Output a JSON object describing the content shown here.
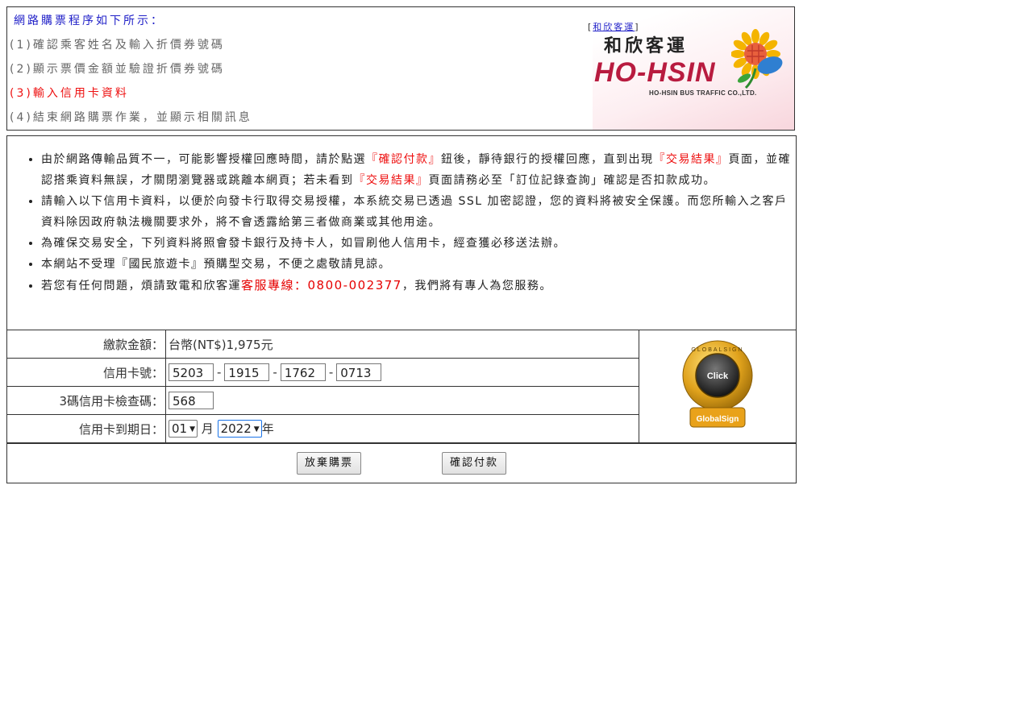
{
  "steps": {
    "title": "網路購票程序如下所示：",
    "items": [
      "(1)確認乘客姓名及輸入折價券號碼",
      "(2)顯示票價金額並驗證折價券號碼",
      "(3)輸入信用卡資料",
      "(4)結束網路購票作業，並顯示相關訊息"
    ],
    "active_index": 2
  },
  "logo": {
    "link_text": "和欣客運",
    "name_zh": "和欣客運",
    "name_en": "HO-HSIN",
    "subtitle": "HO-HSIN BUS TRAFFIC CO.,LTD."
  },
  "notices": {
    "n1_a": "由於網路傳輸品質不一，可能影響授權回應時間，請於點選",
    "n1_b": "『確認付款』",
    "n1_c": "鈕後，靜待銀行的授權回應，直到出現",
    "n1_d": "『交易結果』",
    "n1_e": "頁面，並確認搭乘資料無誤，才關閉瀏覽器或跳離本網頁；若未看到",
    "n1_f": "『交易結果』",
    "n1_g": "頁面請務必至「訂位記錄查詢」確認是否扣款成功。",
    "n2": "請輸入以下信用卡資料，以便於向發卡行取得交易授權，本系統交易已透過 SSL 加密認證，您的資料將被安全保護。而您所輸入之客戶資料除因政府執法機關要求外，將不會透露給第三者做商業或其他用途。",
    "n3": "為確保交易安全，下列資料將照會發卡銀行及持卡人，如冒刷他人信用卡，經查獲必移送法辦。",
    "n4": "本網站不受理『國民旅遊卡』預購型交易，不便之處敬請見諒。",
    "n5_a": "若您有任何問題，煩請致電和欣客運",
    "n5_b": "客服專線：0800-002377",
    "n5_c": "，我們將有專人為您服務。"
  },
  "form": {
    "amount_label": "繳款金額：",
    "amount_value": "台幣(NT$)1,975元",
    "card_label": "信用卡號：",
    "card_parts": [
      "5203",
      "1915",
      "1762",
      "0713"
    ],
    "card_sep": "-",
    "cvv_label": "3碼信用卡檢查碼：",
    "cvv_value": "568",
    "expiry_label": "信用卡到期日：",
    "expiry_month": "01",
    "month_unit": "月",
    "expiry_year": "2022",
    "year_unit": "年"
  },
  "seal": {
    "text_top": "GLOBALSIGN",
    "text_center": "Click",
    "text_bottom": "GlobalSign"
  },
  "buttons": {
    "cancel": "放棄購票",
    "confirm": "確認付款"
  },
  "colors": {
    "title_blue": "#2121c8",
    "active_red": "#ee1111",
    "brand_red": "#b81b3f"
  }
}
